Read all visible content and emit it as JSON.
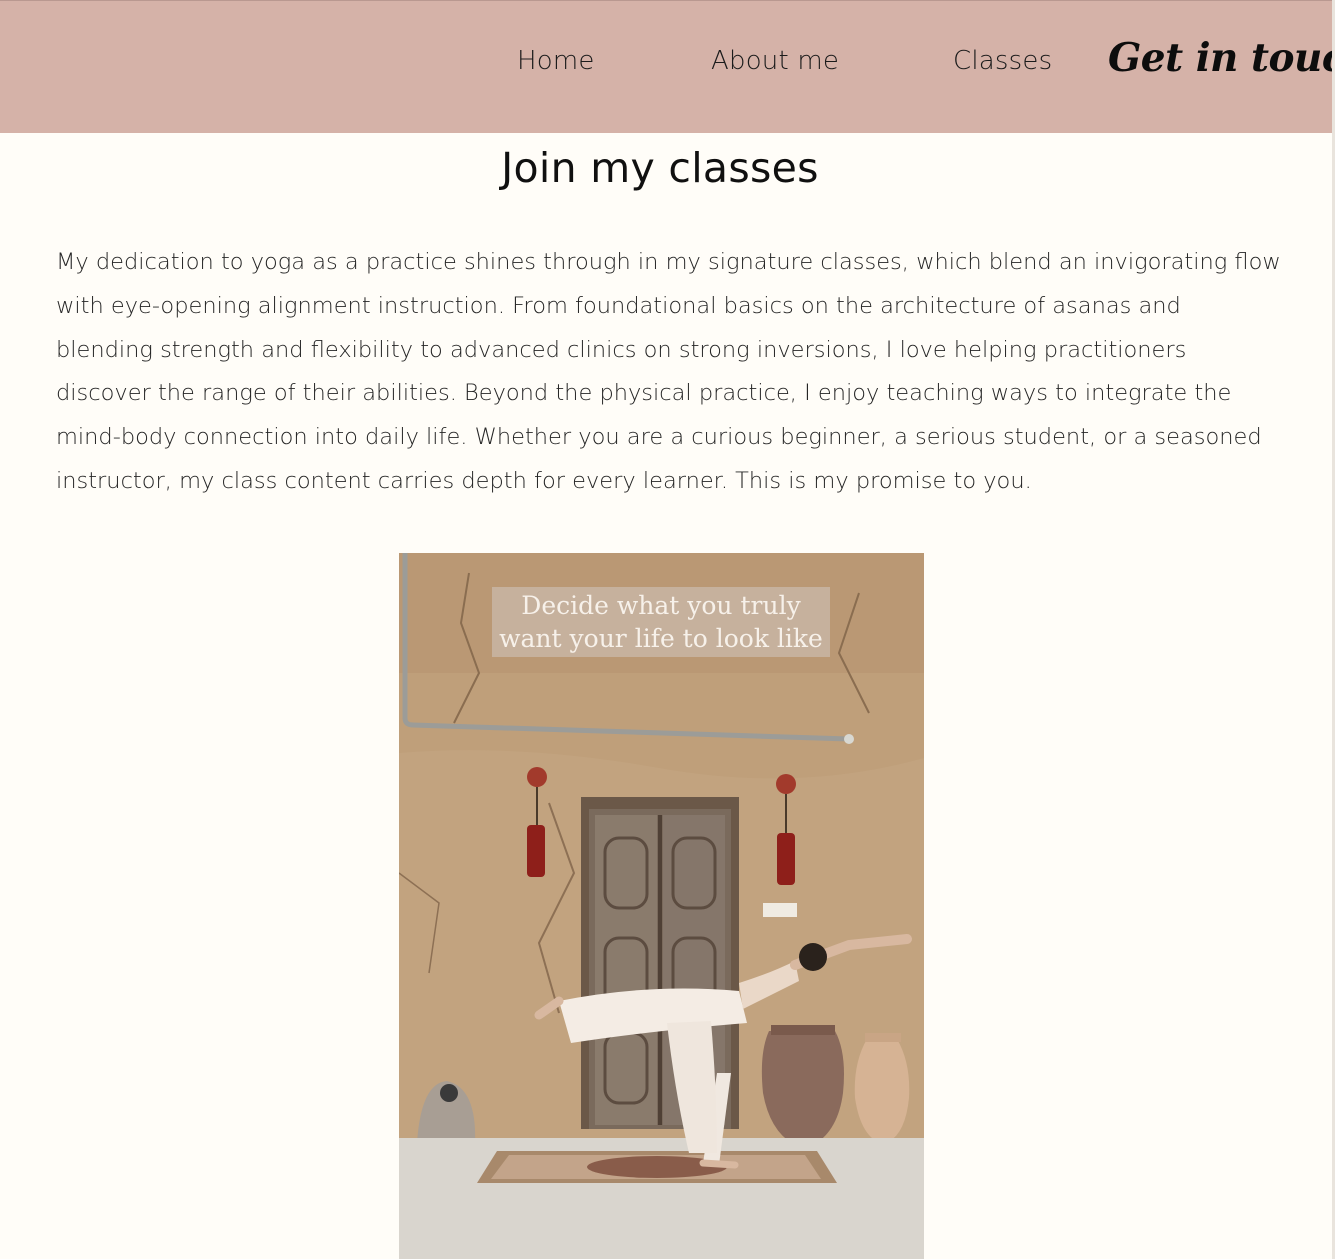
{
  "nav": {
    "home": "Home",
    "about": "About me",
    "classes": "Classes",
    "cta": "Get in touch"
  },
  "main": {
    "title": "Join my classes",
    "intro": "My dedication to yoga as a practice shines through in my signature classes, which blend an invigorating flow with eye-opening alignment instruction. From foundational basics on the architecture of asanas and blending strength and flexibility to advanced clinics on strong inversions, I love helping practitioners discover the range of their abilities. Beyond the physical practice, I enjoy teaching ways to integrate the mind-body connection into daily life. Whether you are a curious beginner, a serious student, or a seasoned instructor, my class content carries depth for every learner. This is my promise to you.",
    "photo": {
      "caption_line1": "Decide what you truly",
      "caption_line2": "want your life to look like"
    }
  },
  "colors": {
    "header_bg": "#d5b2a8",
    "page_bg": "#fffdf8",
    "text": "#1e1e1e"
  }
}
